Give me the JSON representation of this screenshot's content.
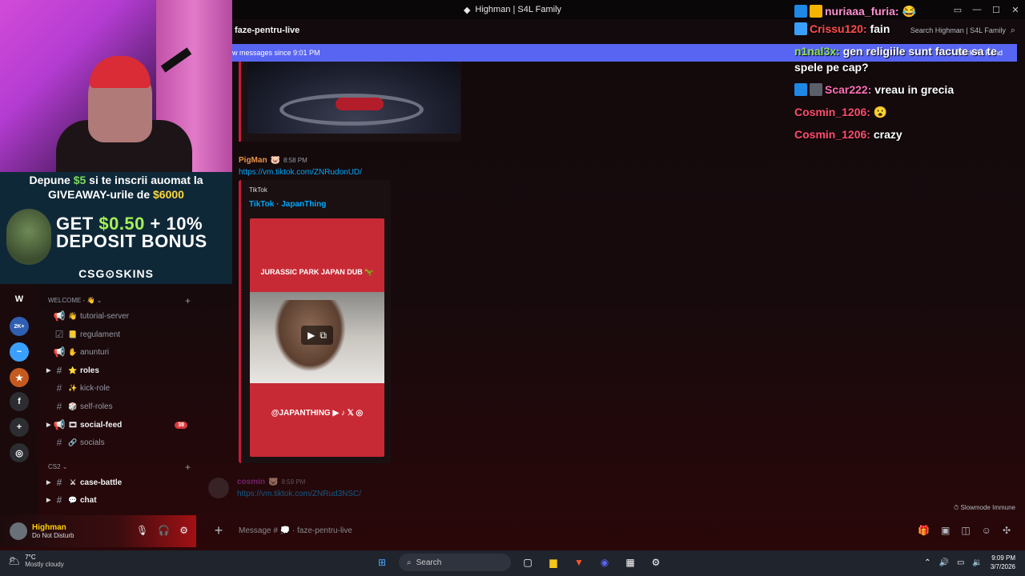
{
  "window": {
    "title": "Highman | S4L Family"
  },
  "channel": {
    "name": "faze-pentru-live",
    "search_placeholder": "Search Highman | S4L Family"
  },
  "new_messages_bar": {
    "text": "w messages since 9:01 PM",
    "action": "Mark As Read"
  },
  "messages": [
    {
      "author": "PigMan",
      "time": "8:58 PM",
      "link": "https://vm.tiktok.com/ZNRudonUD/",
      "embed": {
        "provider": "TikTok",
        "title": "TikTok · JapanThing",
        "thumb_top": "JURASSIC PARK JAPAN DUB 🦖",
        "thumb_bottom": "@JAPANTHING ▶ ♪ 𝕏 ◎"
      }
    },
    {
      "author": "cosmin",
      "time": "8:59 PM",
      "link": "https://vm.tiktok.com/ZNRud3NSC/"
    }
  ],
  "slowmode": "Slowmode Immune",
  "composer": {
    "placeholder": "Message # 💭 · faze-pentru-live"
  },
  "overlay": {
    "promo_line1_a": "Depune ",
    "promo_line1_b": "$5",
    "promo_line1_c": " si te inscrii auomat la",
    "promo_line2_a": "GIVEAWAY-urile de ",
    "promo_line2_b": "$6000",
    "promo_big1_a": "GET ",
    "promo_big1_b": "$0.50",
    "promo_big1_c": " + 10%",
    "promo_big2": "DEPOSIT BONUS",
    "promo_brand": "CSG⊙SKINS"
  },
  "sidebar": {
    "servers": [
      {
        "label": "W",
        "color": "#1a0a0c"
      },
      {
        "label": "2K+",
        "color": "#2f5fb0"
      },
      {
        "label": "~",
        "color": "#3aa0ff"
      },
      {
        "label": "★",
        "color": "#c45a1e"
      },
      {
        "label": "f",
        "color": "#2b2d31"
      },
      {
        "label": "+",
        "color": "#2b2d31"
      },
      {
        "label": "◎",
        "color": "#2b2d31"
      }
    ],
    "categories": [
      {
        "name": "WELCOME - 👋 ⌄"
      },
      {
        "name": "CS2 ⌄"
      }
    ],
    "channels": [
      {
        "name": "tutorial-server",
        "emoji": "👋",
        "icon": "📢",
        "bold": false,
        "arrow": ""
      },
      {
        "name": "regulament",
        "emoji": "📒",
        "icon": "☑",
        "bold": false,
        "arrow": ""
      },
      {
        "name": "anunturi",
        "emoji": "✋",
        "icon": "📢",
        "bold": false,
        "arrow": ""
      },
      {
        "name": "roles",
        "emoji": "⭐",
        "icon": "#",
        "bold": true,
        "arrow": "▶"
      },
      {
        "name": "kick-role",
        "emoji": "✨",
        "icon": "#",
        "bold": false,
        "arrow": ""
      },
      {
        "name": "self-roles",
        "emoji": "🎲",
        "icon": "#",
        "bold": false,
        "arrow": ""
      },
      {
        "name": "social-feed",
        "emoji": "🎞",
        "icon": "📢",
        "bold": true,
        "arrow": "▶",
        "badge": "38"
      },
      {
        "name": "socials",
        "emoji": "🔗",
        "icon": "#",
        "bold": false,
        "arrow": ""
      },
      {
        "name": "case-battle",
        "emoji": "⚔",
        "icon": "#",
        "bold": true,
        "arrow": "▶"
      },
      {
        "name": "chat",
        "emoji": "💬",
        "icon": "#",
        "bold": true,
        "arrow": "▶"
      }
    ]
  },
  "user": {
    "name": "Highman",
    "status": "Do Not Disturb"
  },
  "stream_chat": [
    {
      "user": "nuriaaa_furia:",
      "text": "😂",
      "color": "#ff8fd0"
    },
    {
      "user": "Crissu120:",
      "text": "fain",
      "color": "#ff4d4d"
    },
    {
      "user": "n1nal3x:",
      "text": "gen religiile sunt facute sa te spele pe cap?",
      "color": "#8ee05a"
    },
    {
      "user": "Scar222:",
      "text": "vreau in grecia",
      "color": "#ff6fb5"
    },
    {
      "user": "Cosmin_1206:",
      "text": "😮",
      "color": "#ff4d6d"
    },
    {
      "user": "Cosmin_1206:",
      "text": "crazy",
      "color": "#ff4d6d"
    }
  ],
  "taskbar": {
    "temp": "7°C",
    "weather": "Mostly cloudy",
    "search": "Search",
    "time": "9:09 PM",
    "date": "3/7/2026"
  }
}
